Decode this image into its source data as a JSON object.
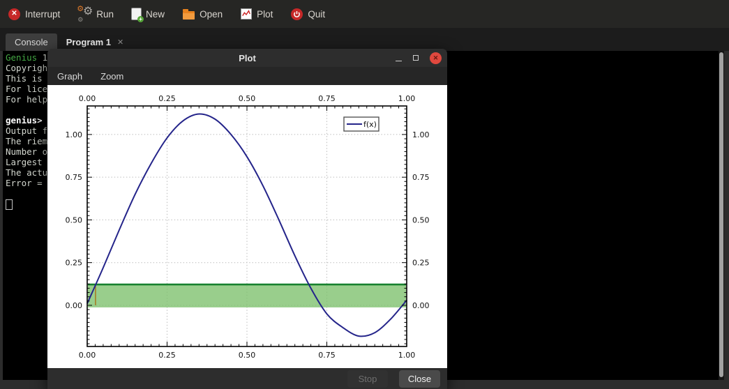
{
  "colors": {
    "accent-green": "#45a945",
    "icon-red": "#c62828",
    "folder-orange": "#e8821e",
    "close-red": "#e0483e"
  },
  "toolbar": {
    "items": {
      "interrupt": "Interrupt",
      "run": "Run",
      "new": "New",
      "open": "Open",
      "plot": "Plot",
      "quit": "Quit"
    }
  },
  "tabs": [
    {
      "label": "Console",
      "active": true
    },
    {
      "label": "Program 1",
      "active": false,
      "close": "✕"
    }
  ],
  "console": {
    "lines": [
      {
        "parts": [
          {
            "text": "Genius",
            "cls": "green"
          },
          {
            "text": " 1"
          }
        ]
      },
      {
        "parts": [
          {
            "text": "Copyrigh"
          }
        ]
      },
      {
        "parts": [
          {
            "text": "This is "
          }
        ]
      },
      {
        "parts": [
          {
            "text": "For lice"
          }
        ]
      },
      {
        "parts": [
          {
            "text": "For help"
          }
        ]
      },
      {
        "parts": []
      },
      {
        "parts": [
          {
            "text": "genius>",
            "cls": "bold"
          }
        ]
      },
      {
        "parts": [
          {
            "text": "Output f"
          }
        ]
      },
      {
        "parts": [
          {
            "text": "The riem"
          }
        ]
      },
      {
        "parts": [
          {
            "text": "Number o"
          }
        ]
      },
      {
        "parts": [
          {
            "text": "Largest"
          }
        ]
      },
      {
        "parts": [
          {
            "text": "The actu"
          }
        ]
      },
      {
        "parts": [
          {
            "text": "Error ="
          }
        ]
      },
      {
        "parts": []
      },
      {
        "cursor": true,
        "parts": []
      }
    ]
  },
  "plot_window": {
    "title": "Plot",
    "menu": [
      "Graph",
      "Zoom"
    ],
    "actions": {
      "stop": "Stop",
      "close": "Close"
    }
  },
  "chart_data": {
    "type": "line",
    "title": "",
    "xlabel": "",
    "ylabel": "",
    "xlim": [
      0,
      1
    ],
    "ylim": [
      -0.241,
      1.167
    ],
    "x_ticks": [
      0,
      0.25,
      0.5,
      0.75,
      1
    ],
    "y_ticks": [
      0,
      0.25,
      0.5,
      0.75,
      1
    ],
    "minor_tick_step": 0.025,
    "grid": true,
    "legend_position": "top-right",
    "series": [
      {
        "name": "f(x)",
        "color": "#24248a",
        "x": [
          0,
          0.05,
          0.1,
          0.15,
          0.2,
          0.25,
          0.3,
          0.35,
          0.4,
          0.45,
          0.5,
          0.55,
          0.6,
          0.65,
          0.7,
          0.75,
          0.8,
          0.85,
          0.9,
          0.95,
          1
        ],
        "y": [
          0.01,
          0.22,
          0.44,
          0.65,
          0.83,
          0.98,
          1.08,
          1.12,
          1.09,
          1.0,
          0.87,
          0.7,
          0.5,
          0.29,
          0.1,
          -0.05,
          -0.13,
          -0.18,
          -0.16,
          -0.08,
          0.03
        ]
      }
    ],
    "annotations": [
      {
        "type": "hband",
        "label": "integral-band",
        "y_from": 0,
        "y_to": 0.122,
        "fill": "#7cc06c",
        "fill_opacity": 0.78,
        "top_line_color": "#17812f"
      },
      {
        "type": "vline",
        "label": "interval-marker",
        "x": 0.026,
        "y_from": 0,
        "y_to": 0.122,
        "color": "#a8690f"
      }
    ]
  }
}
